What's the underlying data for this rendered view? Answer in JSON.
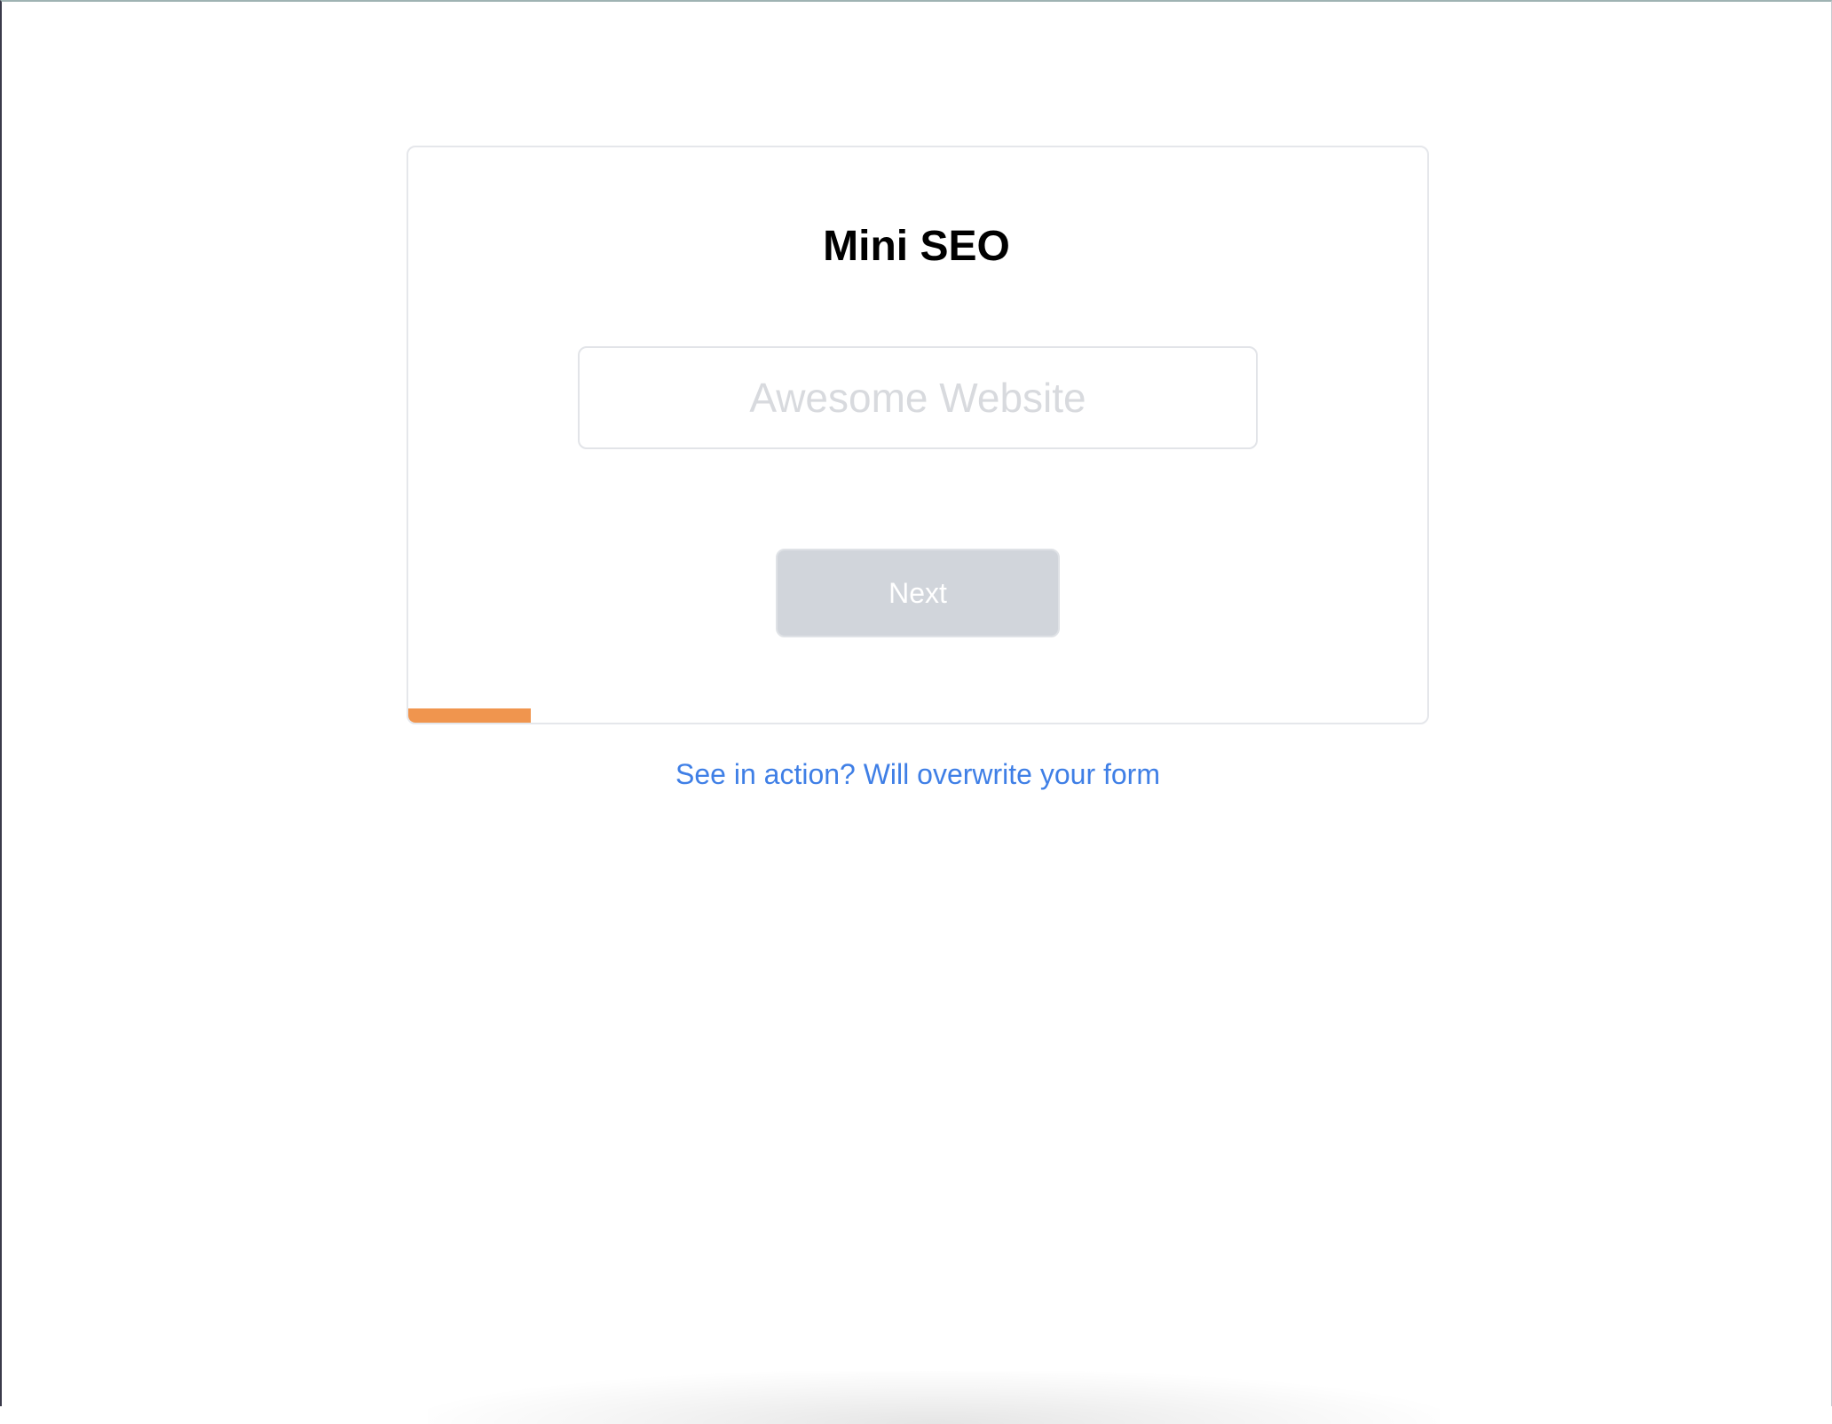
{
  "form": {
    "title": "Mini SEO",
    "website_input": {
      "value": "",
      "placeholder": "Awesome Website"
    },
    "next_label": "Next",
    "progress": {
      "fraction": 0.12,
      "color": "#f0954e"
    }
  },
  "demo_link": {
    "label": "See in action? Will overwrite your form",
    "color": "#3f7fe6"
  },
  "colors": {
    "button_disabled": "#d1d5db",
    "card_border": "#e5e7eb"
  }
}
